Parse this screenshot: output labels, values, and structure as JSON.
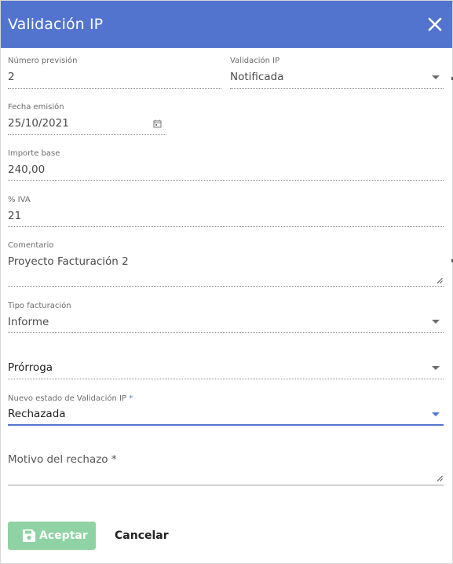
{
  "dialog": {
    "title": "Validación IP",
    "close_icon": "close-icon"
  },
  "fields": {
    "numero_prevision": {
      "label": "Número previsión",
      "value": "2"
    },
    "validacion_ip": {
      "label": "Validación IP",
      "value": "Notificada"
    },
    "fecha_emision": {
      "label": "Fecha emisión",
      "value": "25/10/2021",
      "icon": "calendar-icon"
    },
    "importe_base": {
      "label": "Importe base",
      "value": "240,00"
    },
    "iva": {
      "label": "% IVA",
      "value": "21"
    },
    "comentario": {
      "label": "Comentario",
      "value": "Proyecto Facturación 2"
    },
    "tipo_facturacion": {
      "label": "Tipo facturación",
      "value": "Informe"
    },
    "prorroga": {
      "value": "Prórroga"
    },
    "nuevo_estado": {
      "label": "Nuevo estado de Validación IP",
      "required_mark": "*",
      "value": "Rechazada"
    },
    "motivo_rechazo": {
      "placeholder": "Motivo del rechazo *"
    }
  },
  "actions": {
    "accept_label": "Aceptar",
    "accept_icon": "save-icon",
    "cancel_label": "Cancelar"
  },
  "colors": {
    "header": "#5274cf",
    "accent": "#5274cf",
    "accept_button": "#8fd3a4"
  }
}
